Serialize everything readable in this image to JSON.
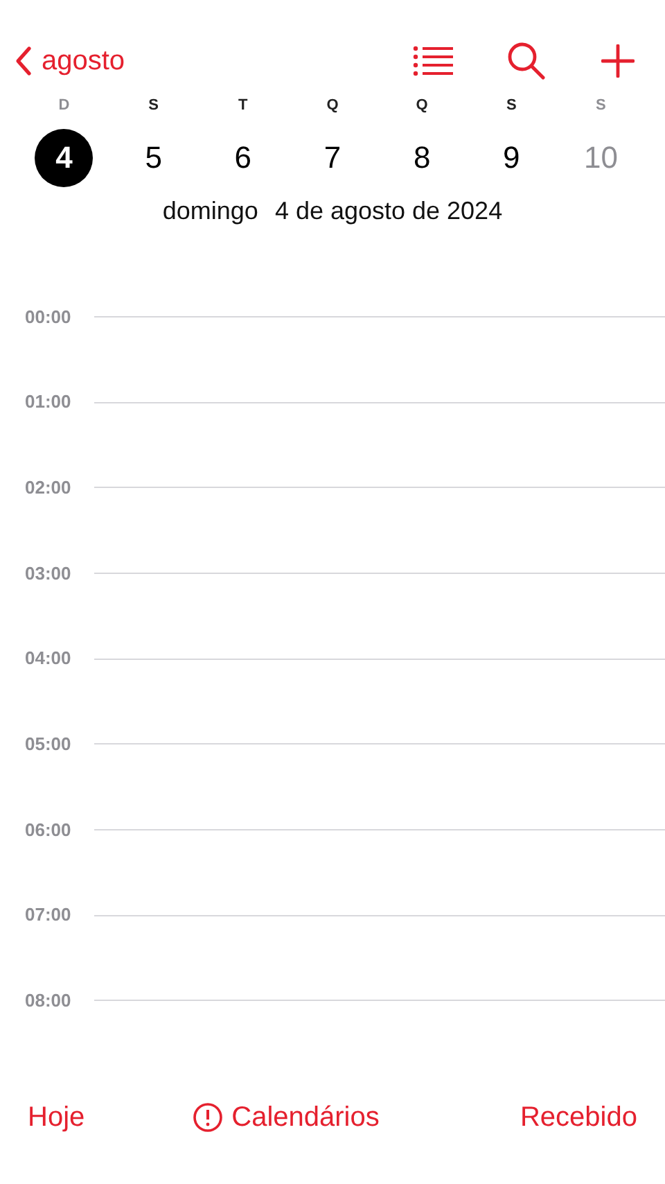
{
  "nav": {
    "back_label": "agosto"
  },
  "week": [
    {
      "letter": "D",
      "day": "4",
      "selected": true,
      "weekend": true
    },
    {
      "letter": "S",
      "day": "5",
      "selected": false,
      "weekend": false
    },
    {
      "letter": "T",
      "day": "6",
      "selected": false,
      "weekend": false
    },
    {
      "letter": "Q",
      "day": "7",
      "selected": false,
      "weekend": false
    },
    {
      "letter": "Q",
      "day": "8",
      "selected": false,
      "weekend": false
    },
    {
      "letter": "S",
      "day": "9",
      "selected": false,
      "weekend": false
    },
    {
      "letter": "S",
      "day": "10",
      "selected": false,
      "weekend": true
    }
  ],
  "date_label": {
    "weekday": "domingo",
    "date": "4 de agosto de 2024"
  },
  "hours": [
    "00:00",
    "01:00",
    "02:00",
    "03:00",
    "04:00",
    "05:00",
    "06:00",
    "07:00",
    "08:00"
  ],
  "toolbar": {
    "today": "Hoje",
    "calendars": "Calendários",
    "inbox": "Recebido"
  }
}
